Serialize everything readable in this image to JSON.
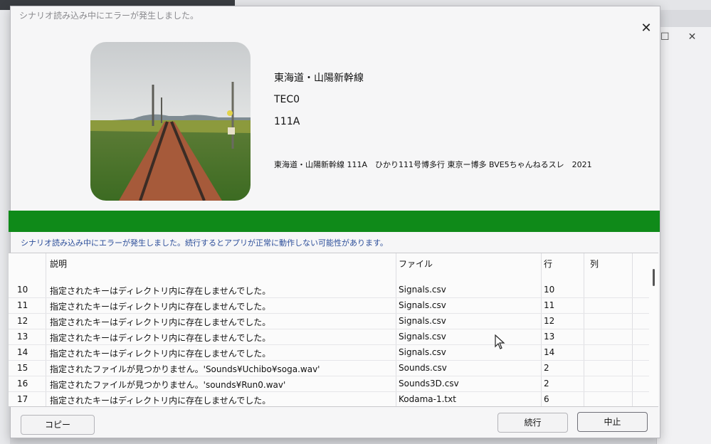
{
  "dialog": {
    "title": "シナリオ読み込み中にエラーが発生しました。",
    "route_name": "東海道・山陽新幹線",
    "vehicle": "TEC0",
    "train_number": "111A",
    "description": "東海道・山陽新幹線 111A　ひかり111号博多行 東京ー博多 BVE5ちゃんねるスレ　2021",
    "progress_percent": 100,
    "error_message": "シナリオ読み込み中にエラーが発生しました。続行するとアプリが正常に動作しない可能性があります。"
  },
  "table": {
    "columns": [
      "説明",
      "ファイル",
      "行",
      "列"
    ],
    "rows": [
      {
        "no": "10",
        "desc": "指定されたキーはディレクトリ内に存在しませんでした。",
        "file": "Signals.csv",
        "line": "10",
        "col": ""
      },
      {
        "no": "11",
        "desc": "指定されたキーはディレクトリ内に存在しませんでした。",
        "file": "Signals.csv",
        "line": "11",
        "col": ""
      },
      {
        "no": "12",
        "desc": "指定されたキーはディレクトリ内に存在しませんでした。",
        "file": "Signals.csv",
        "line": "12",
        "col": ""
      },
      {
        "no": "13",
        "desc": "指定されたキーはディレクトリ内に存在しませんでした。",
        "file": "Signals.csv",
        "line": "13",
        "col": ""
      },
      {
        "no": "14",
        "desc": "指定されたキーはディレクトリ内に存在しませんでした。",
        "file": "Signals.csv",
        "line": "14",
        "col": ""
      },
      {
        "no": "15",
        "desc": "指定されたファイルが見つかりません。'Sounds¥Uchibo¥soga.wav'",
        "file": "Sounds.csv",
        "line": "2",
        "col": ""
      },
      {
        "no": "16",
        "desc": "指定されたファイルが見つかりません。'sounds¥Run0.wav'",
        "file": "Sounds3D.csv",
        "line": "2",
        "col": ""
      },
      {
        "no": "17",
        "desc": "指定されたキーはディレクトリ内に存在しませんでした。",
        "file": "Kodama-1.txt",
        "line": "6",
        "col": ""
      }
    ]
  },
  "buttons": {
    "copy": "コピー",
    "continue": "続行",
    "abort": "中止"
  },
  "icons": {
    "close": "close-icon",
    "maximize": "maximize-icon",
    "cursor": "mouse-pointer-icon"
  },
  "colors": {
    "progress": "#0f8a19",
    "error_text": "#2c4e9a"
  }
}
